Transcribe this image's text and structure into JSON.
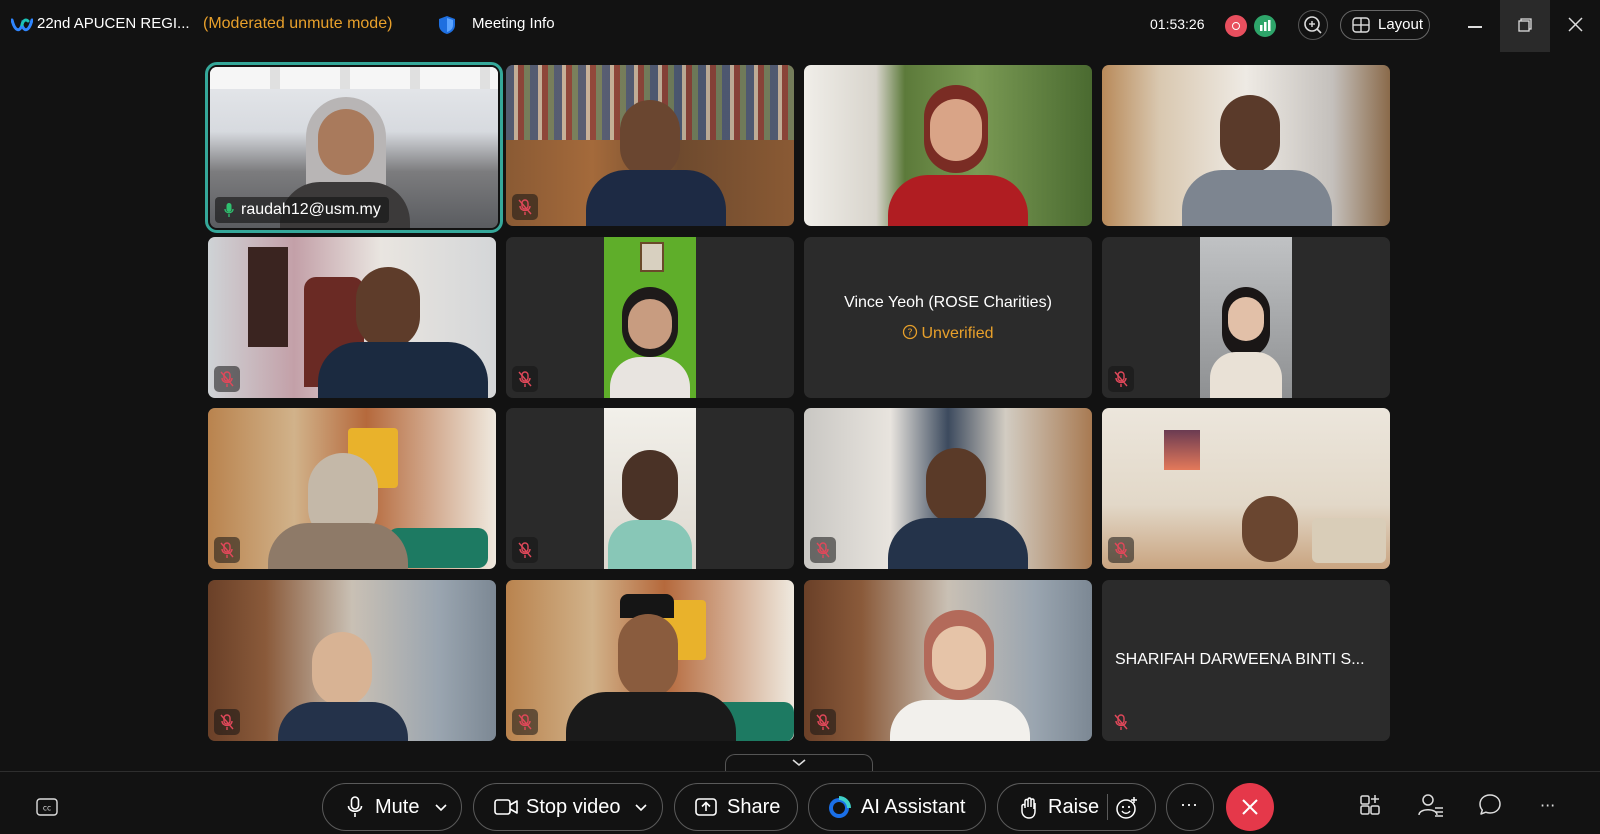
{
  "titlebar": {
    "app_title": "22nd APUCEN REGI...",
    "mode": "(Moderated unmute mode)",
    "meeting_info": "Meeting Info",
    "timer": "01:53:26",
    "layout_label": "Layout"
  },
  "participants": {
    "active_name": "raudah12@usm.my",
    "placeholder_name": "Vince Yeoh (ROSE Charities)",
    "unverified_label": "Unverified",
    "last_tile_name": "SHARIFAH DARWEENA BINTI S..."
  },
  "controls": {
    "mute_label": "Mute",
    "stop_video_label": "Stop video",
    "share_label": "Share",
    "ai_assistant_label": "AI Assistant",
    "raise_label": "Raise",
    "more_label": "···"
  },
  "colors": {
    "accent_orange": "#e8a02b",
    "active_speaker_border": "#35a89a",
    "end_call_red": "#e5384a",
    "muted_icon": "#e0485a"
  }
}
